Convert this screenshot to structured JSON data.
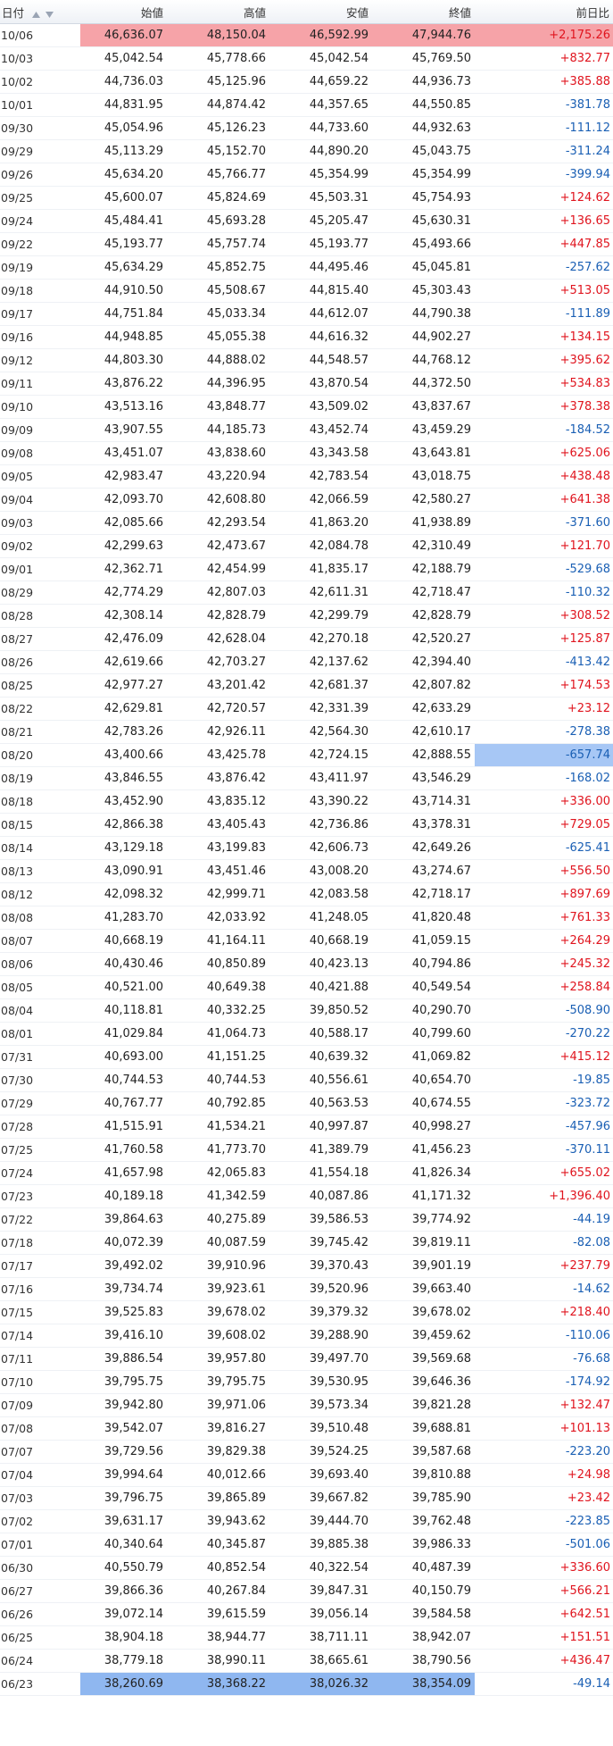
{
  "table": {
    "columns": {
      "date": "日付",
      "open": "始値",
      "high": "高値",
      "low": "安値",
      "close": "終値",
      "change": "前日比"
    },
    "rows": [
      {
        "date": "10/06",
        "open": "46,636.07",
        "high": "48,150.04",
        "low": "46,592.99",
        "close": "47,944.76",
        "change": "+2,175.26"
      },
      {
        "date": "10/03",
        "open": "45,042.54",
        "high": "45,778.66",
        "low": "45,042.54",
        "close": "45,769.50",
        "change": "+832.77"
      },
      {
        "date": "10/02",
        "open": "44,736.03",
        "high": "45,125.96",
        "low": "44,659.22",
        "close": "44,936.73",
        "change": "+385.88"
      },
      {
        "date": "10/01",
        "open": "44,831.95",
        "high": "44,874.42",
        "low": "44,357.65",
        "close": "44,550.85",
        "change": "-381.78"
      },
      {
        "date": "09/30",
        "open": "45,054.96",
        "high": "45,126.23",
        "low": "44,733.60",
        "close": "44,932.63",
        "change": "-111.12"
      },
      {
        "date": "09/29",
        "open": "45,113.29",
        "high": "45,152.70",
        "low": "44,890.20",
        "close": "45,043.75",
        "change": "-311.24"
      },
      {
        "date": "09/26",
        "open": "45,634.20",
        "high": "45,766.77",
        "low": "45,354.99",
        "close": "45,354.99",
        "change": "-399.94"
      },
      {
        "date": "09/25",
        "open": "45,600.07",
        "high": "45,824.69",
        "low": "45,503.31",
        "close": "45,754.93",
        "change": "+124.62"
      },
      {
        "date": "09/24",
        "open": "45,484.41",
        "high": "45,693.28",
        "low": "45,205.47",
        "close": "45,630.31",
        "change": "+136.65"
      },
      {
        "date": "09/22",
        "open": "45,193.77",
        "high": "45,757.74",
        "low": "45,193.77",
        "close": "45,493.66",
        "change": "+447.85"
      },
      {
        "date": "09/19",
        "open": "45,634.29",
        "high": "45,852.75",
        "low": "44,495.46",
        "close": "45,045.81",
        "change": "-257.62"
      },
      {
        "date": "09/18",
        "open": "44,910.50",
        "high": "45,508.67",
        "low": "44,815.40",
        "close": "45,303.43",
        "change": "+513.05"
      },
      {
        "date": "09/17",
        "open": "44,751.84",
        "high": "45,033.34",
        "low": "44,612.07",
        "close": "44,790.38",
        "change": "-111.89"
      },
      {
        "date": "09/16",
        "open": "44,948.85",
        "high": "45,055.38",
        "low": "44,616.32",
        "close": "44,902.27",
        "change": "+134.15"
      },
      {
        "date": "09/12",
        "open": "44,803.30",
        "high": "44,888.02",
        "low": "44,548.57",
        "close": "44,768.12",
        "change": "+395.62"
      },
      {
        "date": "09/11",
        "open": "43,876.22",
        "high": "44,396.95",
        "low": "43,870.54",
        "close": "44,372.50",
        "change": "+534.83"
      },
      {
        "date": "09/10",
        "open": "43,513.16",
        "high": "43,848.77",
        "low": "43,509.02",
        "close": "43,837.67",
        "change": "+378.38"
      },
      {
        "date": "09/09",
        "open": "43,907.55",
        "high": "44,185.73",
        "low": "43,452.74",
        "close": "43,459.29",
        "change": "-184.52"
      },
      {
        "date": "09/08",
        "open": "43,451.07",
        "high": "43,838.60",
        "low": "43,343.58",
        "close": "43,643.81",
        "change": "+625.06"
      },
      {
        "date": "09/05",
        "open": "42,983.47",
        "high": "43,220.94",
        "low": "42,783.54",
        "close": "43,018.75",
        "change": "+438.48"
      },
      {
        "date": "09/04",
        "open": "42,093.70",
        "high": "42,608.80",
        "low": "42,066.59",
        "close": "42,580.27",
        "change": "+641.38"
      },
      {
        "date": "09/03",
        "open": "42,085.66",
        "high": "42,293.54",
        "low": "41,863.20",
        "close": "41,938.89",
        "change": "-371.60"
      },
      {
        "date": "09/02",
        "open": "42,299.63",
        "high": "42,473.67",
        "low": "42,084.78",
        "close": "42,310.49",
        "change": "+121.70"
      },
      {
        "date": "09/01",
        "open": "42,362.71",
        "high": "42,454.99",
        "low": "41,835.17",
        "close": "42,188.79",
        "change": "-529.68"
      },
      {
        "date": "08/29",
        "open": "42,774.29",
        "high": "42,807.03",
        "low": "42,611.31",
        "close": "42,718.47",
        "change": "-110.32"
      },
      {
        "date": "08/28",
        "open": "42,308.14",
        "high": "42,828.79",
        "low": "42,299.79",
        "close": "42,828.79",
        "change": "+308.52"
      },
      {
        "date": "08/27",
        "open": "42,476.09",
        "high": "42,628.04",
        "low": "42,270.18",
        "close": "42,520.27",
        "change": "+125.87"
      },
      {
        "date": "08/26",
        "open": "42,619.66",
        "high": "42,703.27",
        "low": "42,137.62",
        "close": "42,394.40",
        "change": "-413.42"
      },
      {
        "date": "08/25",
        "open": "42,977.27",
        "high": "43,201.42",
        "low": "42,681.37",
        "close": "42,807.82",
        "change": "+174.53"
      },
      {
        "date": "08/22",
        "open": "42,629.81",
        "high": "42,720.57",
        "low": "42,331.39",
        "close": "42,633.29",
        "change": "+23.12"
      },
      {
        "date": "08/21",
        "open": "42,783.26",
        "high": "42,926.11",
        "low": "42,564.30",
        "close": "42,610.17",
        "change": "-278.38"
      },
      {
        "date": "08/20",
        "open": "43,400.66",
        "high": "43,425.78",
        "low": "42,724.15",
        "close": "42,888.55",
        "change": "-657.74"
      },
      {
        "date": "08/19",
        "open": "43,846.55",
        "high": "43,876.42",
        "low": "43,411.97",
        "close": "43,546.29",
        "change": "-168.02"
      },
      {
        "date": "08/18",
        "open": "43,452.90",
        "high": "43,835.12",
        "low": "43,390.22",
        "close": "43,714.31",
        "change": "+336.00"
      },
      {
        "date": "08/15",
        "open": "42,866.38",
        "high": "43,405.43",
        "low": "42,736.86",
        "close": "43,378.31",
        "change": "+729.05"
      },
      {
        "date": "08/14",
        "open": "43,129.18",
        "high": "43,199.83",
        "low": "42,606.73",
        "close": "42,649.26",
        "change": "-625.41"
      },
      {
        "date": "08/13",
        "open": "43,090.91",
        "high": "43,451.46",
        "low": "43,008.20",
        "close": "43,274.67",
        "change": "+556.50"
      },
      {
        "date": "08/12",
        "open": "42,098.32",
        "high": "42,999.71",
        "low": "42,083.58",
        "close": "42,718.17",
        "change": "+897.69"
      },
      {
        "date": "08/08",
        "open": "41,283.70",
        "high": "42,033.92",
        "low": "41,248.05",
        "close": "41,820.48",
        "change": "+761.33"
      },
      {
        "date": "08/07",
        "open": "40,668.19",
        "high": "41,164.11",
        "low": "40,668.19",
        "close": "41,059.15",
        "change": "+264.29"
      },
      {
        "date": "08/06",
        "open": "40,430.46",
        "high": "40,850.89",
        "low": "40,423.13",
        "close": "40,794.86",
        "change": "+245.32"
      },
      {
        "date": "08/05",
        "open": "40,521.00",
        "high": "40,649.38",
        "low": "40,421.88",
        "close": "40,549.54",
        "change": "+258.84"
      },
      {
        "date": "08/04",
        "open": "40,118.81",
        "high": "40,332.25",
        "low": "39,850.52",
        "close": "40,290.70",
        "change": "-508.90"
      },
      {
        "date": "08/01",
        "open": "41,029.84",
        "high": "41,064.73",
        "low": "40,588.17",
        "close": "40,799.60",
        "change": "-270.22"
      },
      {
        "date": "07/31",
        "open": "40,693.00",
        "high": "41,151.25",
        "low": "40,639.32",
        "close": "41,069.82",
        "change": "+415.12"
      },
      {
        "date": "07/30",
        "open": "40,744.53",
        "high": "40,744.53",
        "low": "40,556.61",
        "close": "40,654.70",
        "change": "-19.85"
      },
      {
        "date": "07/29",
        "open": "40,767.77",
        "high": "40,792.85",
        "low": "40,563.53",
        "close": "40,674.55",
        "change": "-323.72"
      },
      {
        "date": "07/28",
        "open": "41,515.91",
        "high": "41,534.21",
        "low": "40,997.87",
        "close": "40,998.27",
        "change": "-457.96"
      },
      {
        "date": "07/25",
        "open": "41,760.58",
        "high": "41,773.70",
        "low": "41,389.79",
        "close": "41,456.23",
        "change": "-370.11"
      },
      {
        "date": "07/24",
        "open": "41,657.98",
        "high": "42,065.83",
        "low": "41,554.18",
        "close": "41,826.34",
        "change": "+655.02"
      },
      {
        "date": "07/23",
        "open": "40,189.18",
        "high": "41,342.59",
        "low": "40,087.86",
        "close": "41,171.32",
        "change": "+1,396.40"
      },
      {
        "date": "07/22",
        "open": "39,864.63",
        "high": "40,275.89",
        "low": "39,586.53",
        "close": "39,774.92",
        "change": "-44.19"
      },
      {
        "date": "07/18",
        "open": "40,072.39",
        "high": "40,087.59",
        "low": "39,745.42",
        "close": "39,819.11",
        "change": "-82.08"
      },
      {
        "date": "07/17",
        "open": "39,492.02",
        "high": "39,910.96",
        "low": "39,370.43",
        "close": "39,901.19",
        "change": "+237.79"
      },
      {
        "date": "07/16",
        "open": "39,734.74",
        "high": "39,923.61",
        "low": "39,520.96",
        "close": "39,663.40",
        "change": "-14.62"
      },
      {
        "date": "07/15",
        "open": "39,525.83",
        "high": "39,678.02",
        "low": "39,379.32",
        "close": "39,678.02",
        "change": "+218.40"
      },
      {
        "date": "07/14",
        "open": "39,416.10",
        "high": "39,608.02",
        "low": "39,288.90",
        "close": "39,459.62",
        "change": "-110.06"
      },
      {
        "date": "07/11",
        "open": "39,886.54",
        "high": "39,957.80",
        "low": "39,497.70",
        "close": "39,569.68",
        "change": "-76.68"
      },
      {
        "date": "07/10",
        "open": "39,795.75",
        "high": "39,795.75",
        "low": "39,530.95",
        "close": "39,646.36",
        "change": "-174.92"
      },
      {
        "date": "07/09",
        "open": "39,942.80",
        "high": "39,971.06",
        "low": "39,573.34",
        "close": "39,821.28",
        "change": "+132.47"
      },
      {
        "date": "07/08",
        "open": "39,542.07",
        "high": "39,816.27",
        "low": "39,510.48",
        "close": "39,688.81",
        "change": "+101.13"
      },
      {
        "date": "07/07",
        "open": "39,729.56",
        "high": "39,829.38",
        "low": "39,524.25",
        "close": "39,587.68",
        "change": "-223.20"
      },
      {
        "date": "07/04",
        "open": "39,994.64",
        "high": "40,012.66",
        "low": "39,693.40",
        "close": "39,810.88",
        "change": "+24.98"
      },
      {
        "date": "07/03",
        "open": "39,796.75",
        "high": "39,865.89",
        "low": "39,667.82",
        "close": "39,785.90",
        "change": "+23.42"
      },
      {
        "date": "07/02",
        "open": "39,631.17",
        "high": "39,943.62",
        "low": "39,444.70",
        "close": "39,762.48",
        "change": "-223.85"
      },
      {
        "date": "07/01",
        "open": "40,340.64",
        "high": "40,345.87",
        "low": "39,885.38",
        "close": "39,986.33",
        "change": "-501.06"
      },
      {
        "date": "06/30",
        "open": "40,550.79",
        "high": "40,852.54",
        "low": "40,322.54",
        "close": "40,487.39",
        "change": "+336.60"
      },
      {
        "date": "06/27",
        "open": "39,866.36",
        "high": "40,267.84",
        "low": "39,847.31",
        "close": "40,150.79",
        "change": "+566.21"
      },
      {
        "date": "06/26",
        "open": "39,072.14",
        "high": "39,615.59",
        "low": "39,056.14",
        "close": "39,584.58",
        "change": "+642.51"
      },
      {
        "date": "06/25",
        "open": "38,904.18",
        "high": "38,944.77",
        "low": "38,711.11",
        "close": "38,942.07",
        "change": "+151.51"
      },
      {
        "date": "06/24",
        "open": "38,779.18",
        "high": "38,990.11",
        "low": "38,665.61",
        "close": "38,790.56",
        "change": "+436.47"
      },
      {
        "date": "06/23",
        "open": "38,260.69",
        "high": "38,368.22",
        "low": "38,026.32",
        "close": "38,354.09",
        "change": "-49.14"
      }
    ]
  },
  "highlights": {
    "max_row_index": 0,
    "min_row_index": 71,
    "min_change_row_index": 31
  },
  "colors": {
    "positive": "#e0141e",
    "negative": "#1a5fb4",
    "highlight_red": "#f6a3a8",
    "highlight_blue": "#8fb7f0"
  },
  "icons": {
    "sort_asc": "triangle-up-icon",
    "sort_desc": "triangle-down-icon"
  }
}
